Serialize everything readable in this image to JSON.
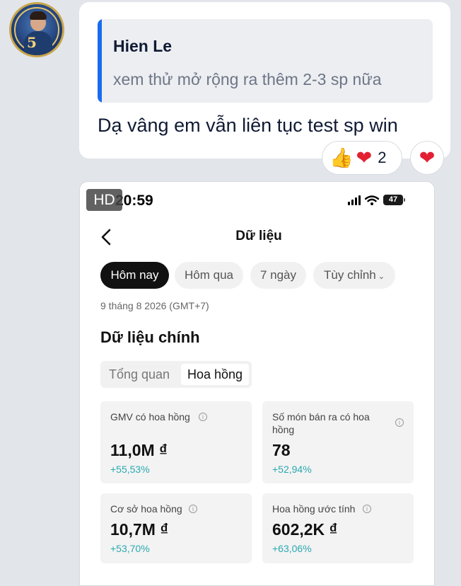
{
  "chat": {
    "quote": {
      "author": "Hien Le",
      "text": "xem thử mở rộng ra thêm 2-3 sp nữa"
    },
    "message": "Dạ vâng em vẫn liên tục test sp win",
    "reactions": [
      {
        "icons": [
          "thumbs-up",
          "heart"
        ],
        "count": "2"
      },
      {
        "icons": [
          "heart"
        ]
      }
    ]
  },
  "screenshot": {
    "hd_badge": "HD",
    "status_bar": {
      "time": "20:59",
      "battery": "47"
    },
    "header": {
      "title": "Dữ liệu"
    },
    "filters": [
      {
        "label": "Hôm nay",
        "active": true
      },
      {
        "label": "Hôm qua"
      },
      {
        "label": "7 ngày"
      },
      {
        "label": "Tùy chỉnh",
        "chevron": "⌄"
      }
    ],
    "date": "9 tháng 8 2026 (GMT+7)",
    "section_title": "Dữ liệu chính",
    "segments": {
      "overview": "Tổng quan",
      "commission": "Hoa hồng"
    },
    "metrics": [
      {
        "title": "GMV có hoa hồng",
        "value": "11,0M ₫",
        "change": "+55,53%"
      },
      {
        "title_line1": "Số món bán ra có hoa",
        "title_line2": "hồng",
        "value": "78",
        "change": "+52,94%"
      },
      {
        "title": "Cơ sở hoa hồng",
        "value": "10,7M ₫",
        "change": "+53,70%"
      },
      {
        "title": "Hoa hồng ước tính",
        "value": "602,2K ₫",
        "change": "+63,06%"
      }
    ],
    "colors": {
      "positive": "#2aa9ad",
      "accent_quote_bar": "#1a6bef"
    }
  }
}
